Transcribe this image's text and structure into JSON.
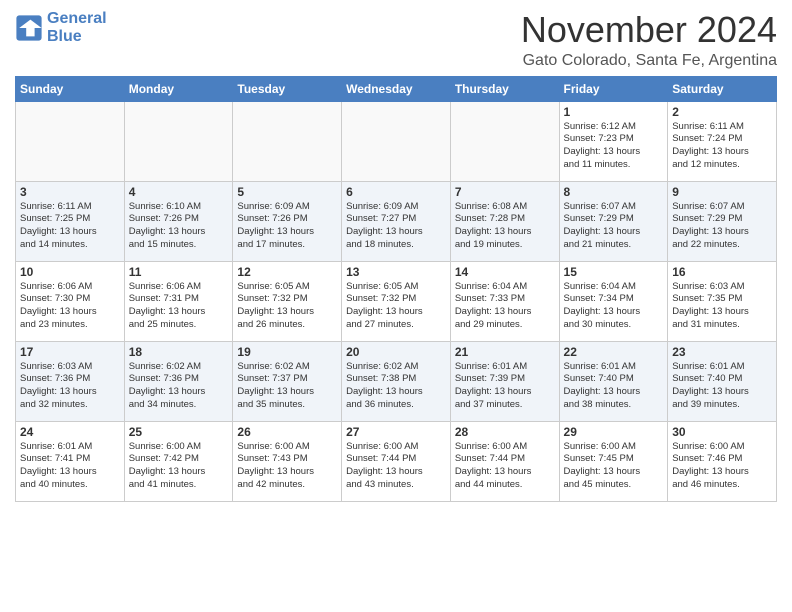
{
  "header": {
    "logo_line1": "General",
    "logo_line2": "Blue",
    "month": "November 2024",
    "location": "Gato Colorado, Santa Fe, Argentina"
  },
  "days_of_week": [
    "Sunday",
    "Monday",
    "Tuesday",
    "Wednesday",
    "Thursday",
    "Friday",
    "Saturday"
  ],
  "weeks": [
    [
      {
        "day": "",
        "info": ""
      },
      {
        "day": "",
        "info": ""
      },
      {
        "day": "",
        "info": ""
      },
      {
        "day": "",
        "info": ""
      },
      {
        "day": "",
        "info": ""
      },
      {
        "day": "1",
        "info": "Sunrise: 6:12 AM\nSunset: 7:23 PM\nDaylight: 13 hours\nand 11 minutes."
      },
      {
        "day": "2",
        "info": "Sunrise: 6:11 AM\nSunset: 7:24 PM\nDaylight: 13 hours\nand 12 minutes."
      }
    ],
    [
      {
        "day": "3",
        "info": "Sunrise: 6:11 AM\nSunset: 7:25 PM\nDaylight: 13 hours\nand 14 minutes."
      },
      {
        "day": "4",
        "info": "Sunrise: 6:10 AM\nSunset: 7:26 PM\nDaylight: 13 hours\nand 15 minutes."
      },
      {
        "day": "5",
        "info": "Sunrise: 6:09 AM\nSunset: 7:26 PM\nDaylight: 13 hours\nand 17 minutes."
      },
      {
        "day": "6",
        "info": "Sunrise: 6:09 AM\nSunset: 7:27 PM\nDaylight: 13 hours\nand 18 minutes."
      },
      {
        "day": "7",
        "info": "Sunrise: 6:08 AM\nSunset: 7:28 PM\nDaylight: 13 hours\nand 19 minutes."
      },
      {
        "day": "8",
        "info": "Sunrise: 6:07 AM\nSunset: 7:29 PM\nDaylight: 13 hours\nand 21 minutes."
      },
      {
        "day": "9",
        "info": "Sunrise: 6:07 AM\nSunset: 7:29 PM\nDaylight: 13 hours\nand 22 minutes."
      }
    ],
    [
      {
        "day": "10",
        "info": "Sunrise: 6:06 AM\nSunset: 7:30 PM\nDaylight: 13 hours\nand 23 minutes."
      },
      {
        "day": "11",
        "info": "Sunrise: 6:06 AM\nSunset: 7:31 PM\nDaylight: 13 hours\nand 25 minutes."
      },
      {
        "day": "12",
        "info": "Sunrise: 6:05 AM\nSunset: 7:32 PM\nDaylight: 13 hours\nand 26 minutes."
      },
      {
        "day": "13",
        "info": "Sunrise: 6:05 AM\nSunset: 7:32 PM\nDaylight: 13 hours\nand 27 minutes."
      },
      {
        "day": "14",
        "info": "Sunrise: 6:04 AM\nSunset: 7:33 PM\nDaylight: 13 hours\nand 29 minutes."
      },
      {
        "day": "15",
        "info": "Sunrise: 6:04 AM\nSunset: 7:34 PM\nDaylight: 13 hours\nand 30 minutes."
      },
      {
        "day": "16",
        "info": "Sunrise: 6:03 AM\nSunset: 7:35 PM\nDaylight: 13 hours\nand 31 minutes."
      }
    ],
    [
      {
        "day": "17",
        "info": "Sunrise: 6:03 AM\nSunset: 7:36 PM\nDaylight: 13 hours\nand 32 minutes."
      },
      {
        "day": "18",
        "info": "Sunrise: 6:02 AM\nSunset: 7:36 PM\nDaylight: 13 hours\nand 34 minutes."
      },
      {
        "day": "19",
        "info": "Sunrise: 6:02 AM\nSunset: 7:37 PM\nDaylight: 13 hours\nand 35 minutes."
      },
      {
        "day": "20",
        "info": "Sunrise: 6:02 AM\nSunset: 7:38 PM\nDaylight: 13 hours\nand 36 minutes."
      },
      {
        "day": "21",
        "info": "Sunrise: 6:01 AM\nSunset: 7:39 PM\nDaylight: 13 hours\nand 37 minutes."
      },
      {
        "day": "22",
        "info": "Sunrise: 6:01 AM\nSunset: 7:40 PM\nDaylight: 13 hours\nand 38 minutes."
      },
      {
        "day": "23",
        "info": "Sunrise: 6:01 AM\nSunset: 7:40 PM\nDaylight: 13 hours\nand 39 minutes."
      }
    ],
    [
      {
        "day": "24",
        "info": "Sunrise: 6:01 AM\nSunset: 7:41 PM\nDaylight: 13 hours\nand 40 minutes."
      },
      {
        "day": "25",
        "info": "Sunrise: 6:00 AM\nSunset: 7:42 PM\nDaylight: 13 hours\nand 41 minutes."
      },
      {
        "day": "26",
        "info": "Sunrise: 6:00 AM\nSunset: 7:43 PM\nDaylight: 13 hours\nand 42 minutes."
      },
      {
        "day": "27",
        "info": "Sunrise: 6:00 AM\nSunset: 7:44 PM\nDaylight: 13 hours\nand 43 minutes."
      },
      {
        "day": "28",
        "info": "Sunrise: 6:00 AM\nSunset: 7:44 PM\nDaylight: 13 hours\nand 44 minutes."
      },
      {
        "day": "29",
        "info": "Sunrise: 6:00 AM\nSunset: 7:45 PM\nDaylight: 13 hours\nand 45 minutes."
      },
      {
        "day": "30",
        "info": "Sunrise: 6:00 AM\nSunset: 7:46 PM\nDaylight: 13 hours\nand 46 minutes."
      }
    ]
  ]
}
